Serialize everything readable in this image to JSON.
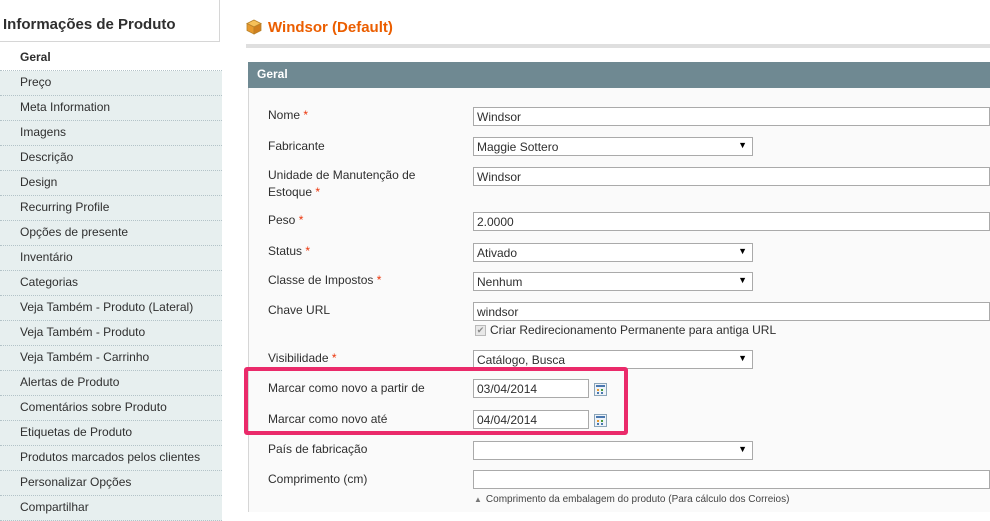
{
  "sidebar": {
    "title": "Informações de Produto",
    "items": [
      {
        "label": "Geral",
        "active": true
      },
      {
        "label": "Preço"
      },
      {
        "label": "Meta Information"
      },
      {
        "label": "Imagens"
      },
      {
        "label": "Descrição"
      },
      {
        "label": "Design"
      },
      {
        "label": "Recurring Profile"
      },
      {
        "label": "Opções de presente"
      },
      {
        "label": "Inventário"
      },
      {
        "label": "Categorias"
      },
      {
        "label": "Veja Também - Produto (Lateral)"
      },
      {
        "label": "Veja Também - Produto"
      },
      {
        "label": "Veja Também - Carrinho"
      },
      {
        "label": "Alertas de Produto"
      },
      {
        "label": "Comentários sobre Produto"
      },
      {
        "label": "Etiquetas de Produto"
      },
      {
        "label": "Produtos marcados pelos clientes"
      },
      {
        "label": "Personalizar Opções"
      },
      {
        "label": "Compartilhar"
      }
    ]
  },
  "header": {
    "title": "Windsor (Default)",
    "icon": "product-cube-icon",
    "title_color": "#eb5e00"
  },
  "section": {
    "title": "Geral"
  },
  "fields": {
    "name": {
      "label": "Nome",
      "required": "*",
      "value": "Windsor"
    },
    "manufacturer": {
      "label": "Fabricante",
      "value": "Maggie Sottero"
    },
    "sku": {
      "label_line1": "Unidade de Manutenção de",
      "label_line2": "Estoque",
      "required": "*",
      "value": "Windsor"
    },
    "weight": {
      "label": "Peso",
      "required": "*",
      "value": "2.0000"
    },
    "status": {
      "label": "Status",
      "required": "*",
      "value": "Ativado"
    },
    "tax_class": {
      "label": "Classe de Impostos",
      "required": "*",
      "value": "Nenhum"
    },
    "url_key": {
      "label": "Chave URL",
      "value": "windsor",
      "checkbox_label": "Criar Redirecionamento Permanente para antiga URL"
    },
    "visibility": {
      "label": "Visibilidade",
      "required": "*",
      "value": "Catálogo, Busca"
    },
    "new_from": {
      "label": "Marcar como novo a partir de",
      "value": "03/04/2014"
    },
    "new_to": {
      "label": "Marcar como novo até",
      "value": "04/04/2014"
    },
    "country": {
      "label": "País de fabricação",
      "value": ""
    },
    "length": {
      "label": "Comprimento (cm)",
      "value": "",
      "note": "Comprimento da embalagem do produto (Para cálculo dos Correios)"
    }
  },
  "colors": {
    "section_header": "#6f8992",
    "highlight": "#ea2a6a",
    "required": "#eb340a"
  }
}
